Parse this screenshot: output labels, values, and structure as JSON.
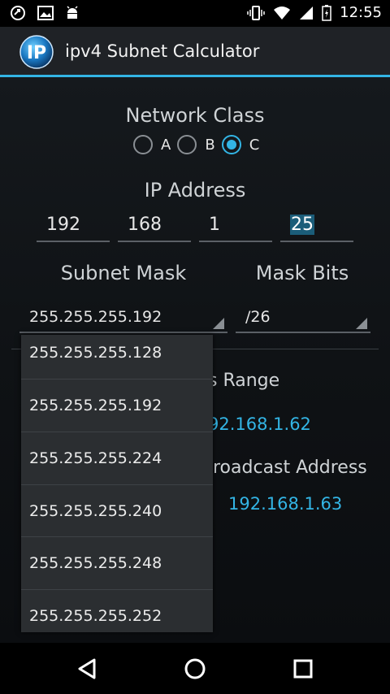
{
  "statusbar": {
    "time": "12:55"
  },
  "app": {
    "title": "ipv4 Subnet Calculator",
    "logo_text": "IP"
  },
  "network_class": {
    "title": "Network Class",
    "options": [
      "A",
      "B",
      "C"
    ],
    "selected": "C"
  },
  "ip_address": {
    "title": "IP Address",
    "octets": [
      "192",
      "168",
      "1",
      "25"
    ]
  },
  "subnet_mask": {
    "title": "Subnet Mask",
    "value": "255.255.255.192"
  },
  "mask_bits": {
    "title": "Mask Bits",
    "value": "/26"
  },
  "results": {
    "range_label_partial": "s Range",
    "range_value_partial": "92.168.1.62",
    "broadcast_label_partial": "roadcast Address",
    "broadcast_value": "192.168.1.63"
  },
  "dropdown": {
    "options": [
      "255.255.255.128",
      "255.255.255.192",
      "255.255.255.224",
      "255.255.255.240",
      "255.255.255.248",
      "255.255.255.252"
    ]
  },
  "colors": {
    "accent": "#33b5e5",
    "background": "#0f1215",
    "actionbar": "#1f2226"
  }
}
